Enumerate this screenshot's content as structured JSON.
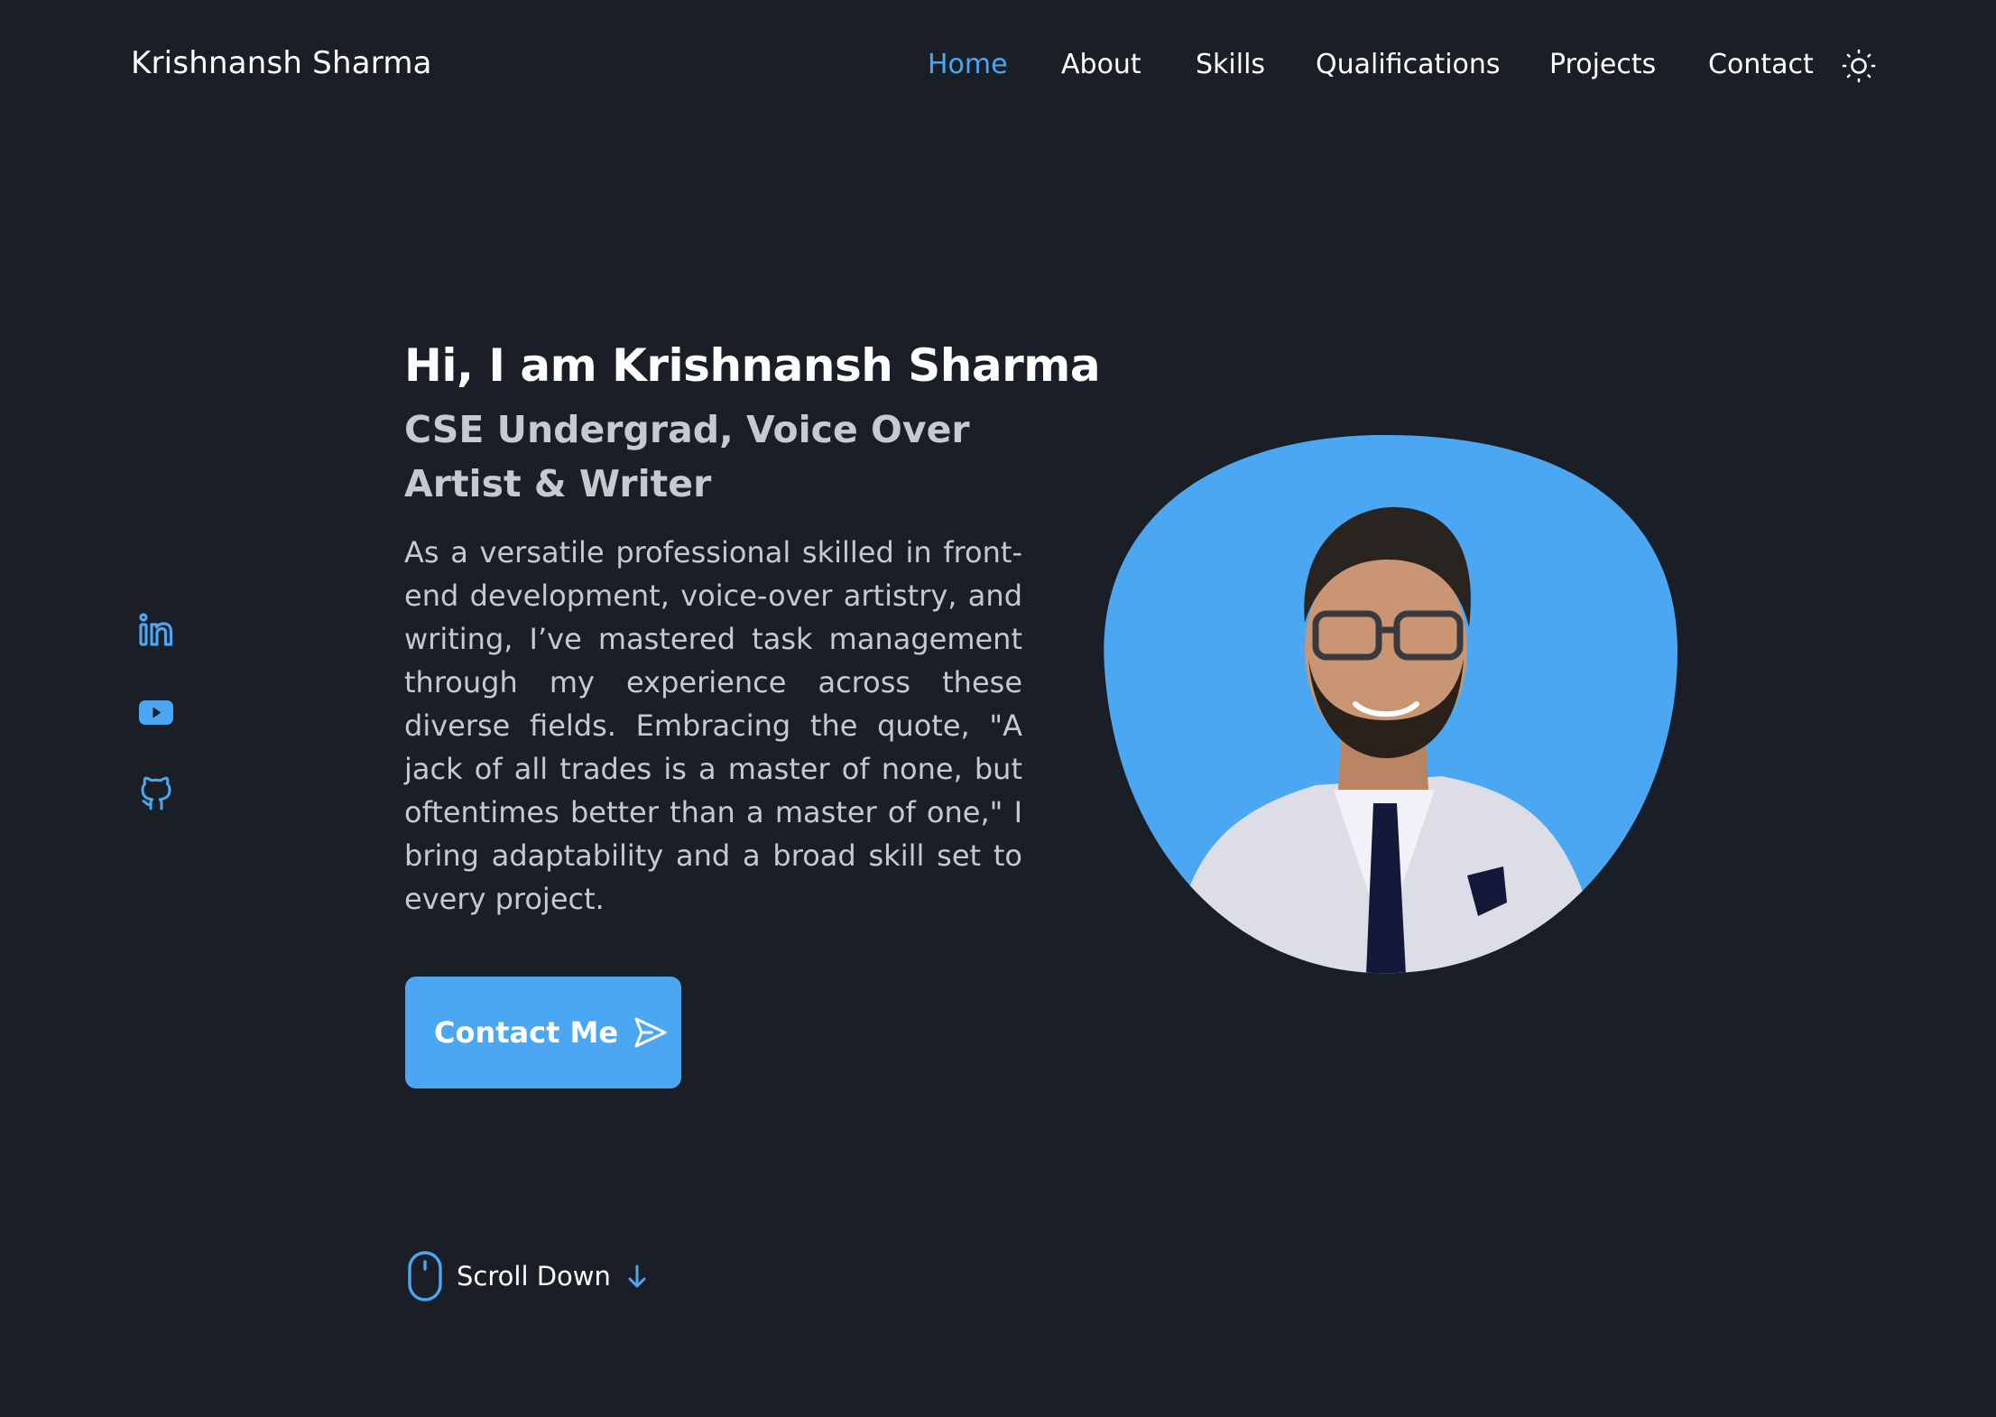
{
  "header": {
    "brand": "Krishnansh Sharma",
    "nav": [
      {
        "label": "Home",
        "active": true
      },
      {
        "label": "About",
        "active": false
      },
      {
        "label": "Skills",
        "active": false
      },
      {
        "label": "Qualifications",
        "active": false
      },
      {
        "label": "Projects",
        "active": false
      },
      {
        "label": "Contact",
        "active": false
      }
    ],
    "theme_icon": "sun-icon"
  },
  "social": [
    {
      "icon": "linkedin-icon"
    },
    {
      "icon": "youtube-icon"
    },
    {
      "icon": "github-icon"
    }
  ],
  "hero": {
    "title": "Hi, I am Krishnansh Sharma",
    "subtitle": "CSE Undergrad, Voice Over Artist & Writer",
    "description": "As a versatile professional skilled in front-end development, voice-over artistry, and writing, I’ve mastered task management through my experience across these diverse fields. Embracing the quote, \"A jack of all trades is a master of none, but oftentimes better than a master of one,\" I bring adaptability and a broad skill set to every project.",
    "cta_label": "Contact Me",
    "cta_icon": "send-icon"
  },
  "scroll": {
    "label": "Scroll Down",
    "icon": "mouse-icon",
    "arrow_icon": "arrow-down-icon"
  },
  "colors": {
    "background": "#1a1f27",
    "accent": "#4ba7f1",
    "text": "#ffffff",
    "muted": "#c6c9ce"
  }
}
